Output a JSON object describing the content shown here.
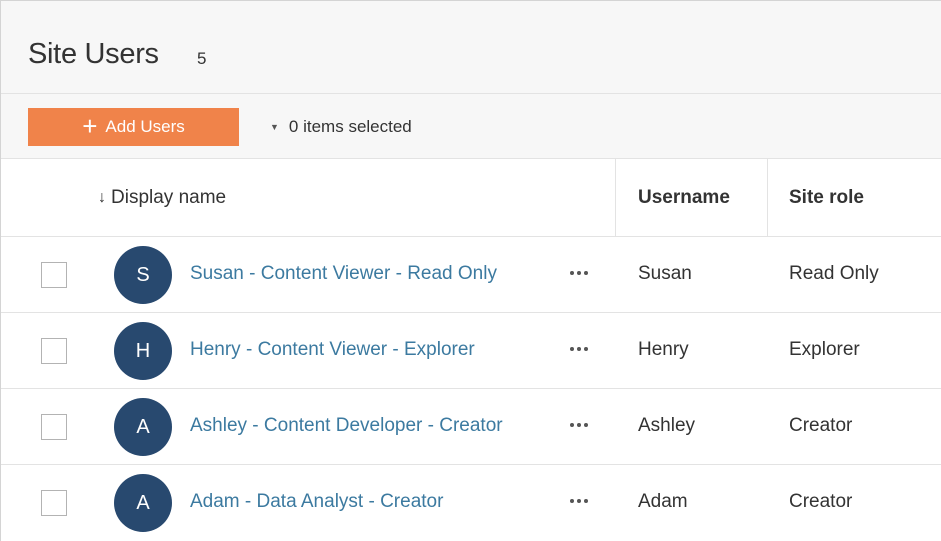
{
  "header": {
    "title": "Site Users",
    "count": "5"
  },
  "toolbar": {
    "add_icon": "plus-icon",
    "add_label": "Add Users",
    "selection_caret": "caret-down-icon",
    "selection_text": "0 items selected"
  },
  "table": {
    "sort_icon": "sort-down-arrow-icon",
    "columns": {
      "display_name": "Display name",
      "username": "Username",
      "site_role": "Site role"
    },
    "rows": [
      {
        "initial": "S",
        "display_name": "Susan - Content Viewer - Read Only",
        "username": "Susan",
        "site_role": "Read Only"
      },
      {
        "initial": "H",
        "display_name": "Henry - Content Viewer - Explorer",
        "username": "Henry",
        "site_role": "Explorer"
      },
      {
        "initial": "A",
        "display_name": "Ashley - Content Developer - Creator",
        "username": "Ashley",
        "site_role": "Creator"
      },
      {
        "initial": "A",
        "display_name": "Adam - Data Analyst - Creator",
        "username": "Adam",
        "site_role": "Creator"
      }
    ]
  },
  "colors": {
    "accent": "#f0834a",
    "avatar": "#28496f",
    "link": "#3c7aa0",
    "panel": "#f7f7f7"
  }
}
